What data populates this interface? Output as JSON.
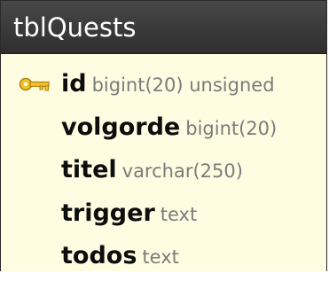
{
  "table": {
    "name": "tblQuests",
    "header_color": "#3a3a3a",
    "body_color": "#fffde1",
    "columns": [
      {
        "name": "id",
        "type": "bigint(20) unsigned",
        "primary_key": true,
        "icon": "primary-key-icon"
      },
      {
        "name": "volgorde",
        "type": "bigint(20)",
        "primary_key": false
      },
      {
        "name": "titel",
        "type": "varchar(250)",
        "primary_key": false
      },
      {
        "name": "trigger",
        "type": "text",
        "primary_key": false
      },
      {
        "name": "todos",
        "type": "text",
        "primary_key": false
      }
    ]
  }
}
